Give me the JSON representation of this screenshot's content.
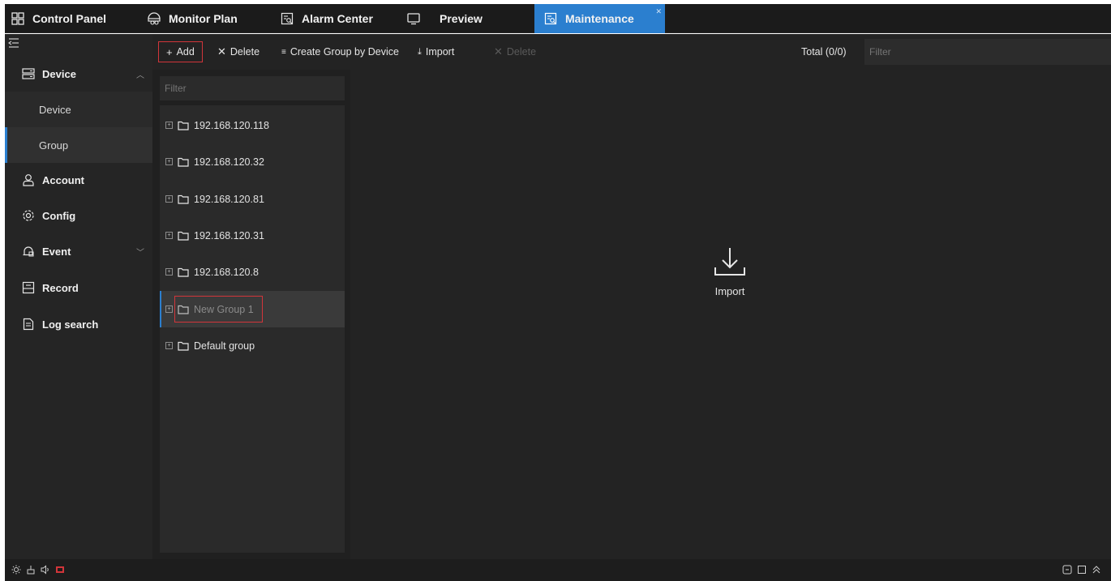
{
  "tabs": [
    {
      "label": "Control Panel",
      "icon": "grid-icon"
    },
    {
      "label": "Monitor Plan",
      "icon": "monitor-plan-icon"
    },
    {
      "label": "Alarm Center",
      "icon": "alarm-center-icon"
    },
    {
      "label": "Preview",
      "icon": "monitor-icon"
    },
    {
      "label": "Maintenance",
      "icon": "maintenance-icon",
      "active": true
    }
  ],
  "sidebar": {
    "items": [
      {
        "label": "Device",
        "icon": "device-icon",
        "expanded": true
      },
      {
        "label": "Device",
        "sub": true
      },
      {
        "label": "Group",
        "sub": true,
        "active": true
      },
      {
        "label": "Account",
        "icon": "account-icon"
      },
      {
        "label": "Config",
        "icon": "gear-icon"
      },
      {
        "label": "Event",
        "icon": "event-icon",
        "expandable": true
      },
      {
        "label": "Record",
        "icon": "record-icon"
      },
      {
        "label": "Log search",
        "icon": "log-search-icon"
      }
    ]
  },
  "toolbar": {
    "add_label": "Add",
    "delete_label": "Delete",
    "create_group_label": "Create Group by Device",
    "import_label": "Import",
    "delete_disabled_label": "Delete",
    "total_label": "Total (0/0)",
    "filter_placeholder": "Filter"
  },
  "tree": {
    "filter_placeholder": "Filter",
    "groups": [
      "192.168.120.118",
      "192.168.120.32",
      "192.168.120.81",
      "192.168.120.31",
      "192.168.120.8",
      "New Group 1",
      "Default group"
    ],
    "selected": "New Group 1"
  },
  "main": {
    "import_label": "Import"
  },
  "colors": {
    "accent": "#2b7fcf",
    "highlight_border": "#d2353a",
    "background": "#232323"
  }
}
